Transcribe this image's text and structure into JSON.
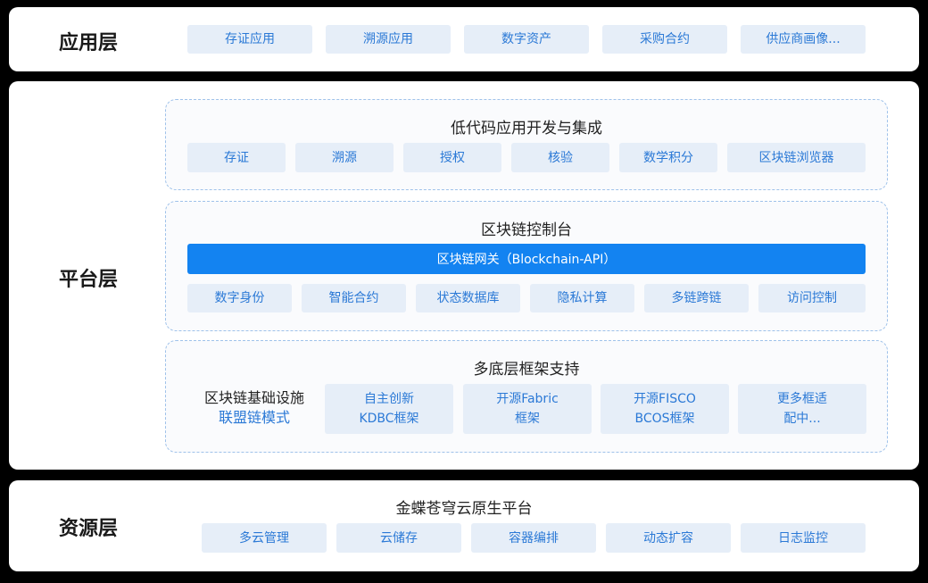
{
  "application": {
    "title": "应用层",
    "items": [
      "存证应用",
      "溯源应用",
      "数字资产",
      "采购合约",
      "供应商画像..."
    ]
  },
  "platform": {
    "title": "平台层",
    "lowcode": {
      "title": "低代码应用开发与集成",
      "items": [
        "存证",
        "溯源",
        "授权",
        "核验",
        "数学积分",
        "区块链浏览器"
      ]
    },
    "console": {
      "title": "区块链控制台",
      "gateway": "区块链网关（Blockchain-API）",
      "items": [
        "数字身份",
        "智能合约",
        "状态数据库",
        "隐私计算",
        "多链跨链",
        "访问控制"
      ]
    },
    "framework": {
      "title": "多底层框架支持",
      "infra_line1": "区块链基础设施",
      "infra_line2": "联盟链模式",
      "items": [
        {
          "line1": "自主创新",
          "line2": "KDBC框架"
        },
        {
          "line1": "开源Fabric",
          "line2": "框架"
        },
        {
          "line1": "开源FISCO",
          "line2": "BCOS框架"
        },
        {
          "line1": "更多框适",
          "line2": "配中..."
        }
      ]
    }
  },
  "resource": {
    "title": "资源层",
    "subtitle": "金蝶苍穹云原生平台",
    "items": [
      "多云管理",
      "云储存",
      "容器编排",
      "动态扩容",
      "日志监控"
    ]
  },
  "colors": {
    "chip_bg": "#e6eef8",
    "chip_text": "#2b79d6",
    "gateway_bg": "#1383f1",
    "section_border": "#9fc2ea"
  }
}
